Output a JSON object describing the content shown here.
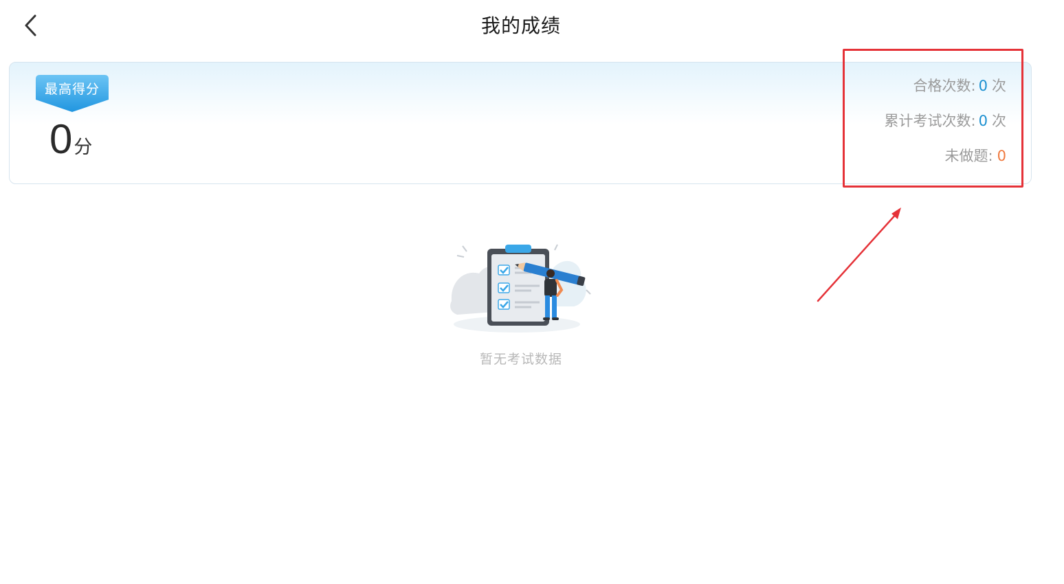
{
  "header": {
    "title": "我的成绩",
    "back_icon": "chevron-left-icon"
  },
  "score_card": {
    "badge_label": "最高得分",
    "high_score_value": "0",
    "high_score_unit": "分",
    "stats": [
      {
        "label": "合格次数:",
        "value": "0",
        "unit": "次"
      },
      {
        "label": "累计考试次数:",
        "value": "0",
        "unit": "次"
      },
      {
        "label": "未做题:",
        "value": "0"
      }
    ]
  },
  "empty_state": {
    "message": "暂无考试数据",
    "illustration_icon": "clipboard-checklist-illustration"
  },
  "colors": {
    "accent_blue": "#1a8fd0",
    "accent_orange": "#f07a3f",
    "annotation_red": "#e53238",
    "badge_blue": "#3aa7e8"
  }
}
